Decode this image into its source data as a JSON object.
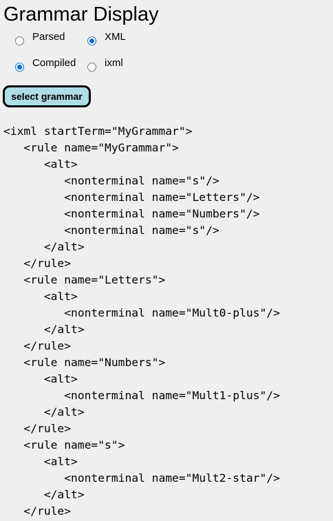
{
  "page": {
    "title": "Grammar Display"
  },
  "view_options": {
    "format": [
      {
        "label": "Parsed",
        "checked": false
      },
      {
        "label": "Compiled",
        "checked": true
      }
    ],
    "output": [
      {
        "label": "XML",
        "checked": true
      },
      {
        "label": "ixml",
        "checked": false
      }
    ]
  },
  "toolbar": {
    "select_grammar_label": "select grammar"
  },
  "output": {
    "lines": [
      "<ixml startTerm=\"MyGrammar\">",
      "   <rule name=\"MyGrammar\">",
      "      <alt>",
      "         <nonterminal name=\"s\"/>",
      "         <nonterminal name=\"Letters\"/>",
      "         <nonterminal name=\"Numbers\"/>",
      "         <nonterminal name=\"s\"/>",
      "      </alt>",
      "   </rule>",
      "   <rule name=\"Letters\">",
      "      <alt>",
      "         <nonterminal name=\"Mult0-plus\"/>",
      "      </alt>",
      "   </rule>",
      "   <rule name=\"Numbers\">",
      "      <alt>",
      "         <nonterminal name=\"Mult1-plus\"/>",
      "      </alt>",
      "   </rule>",
      "   <rule name=\"s\">",
      "      <alt>",
      "         <nonterminal name=\"Mult2-star\"/>",
      "      </alt>",
      "   </rule>"
    ]
  }
}
